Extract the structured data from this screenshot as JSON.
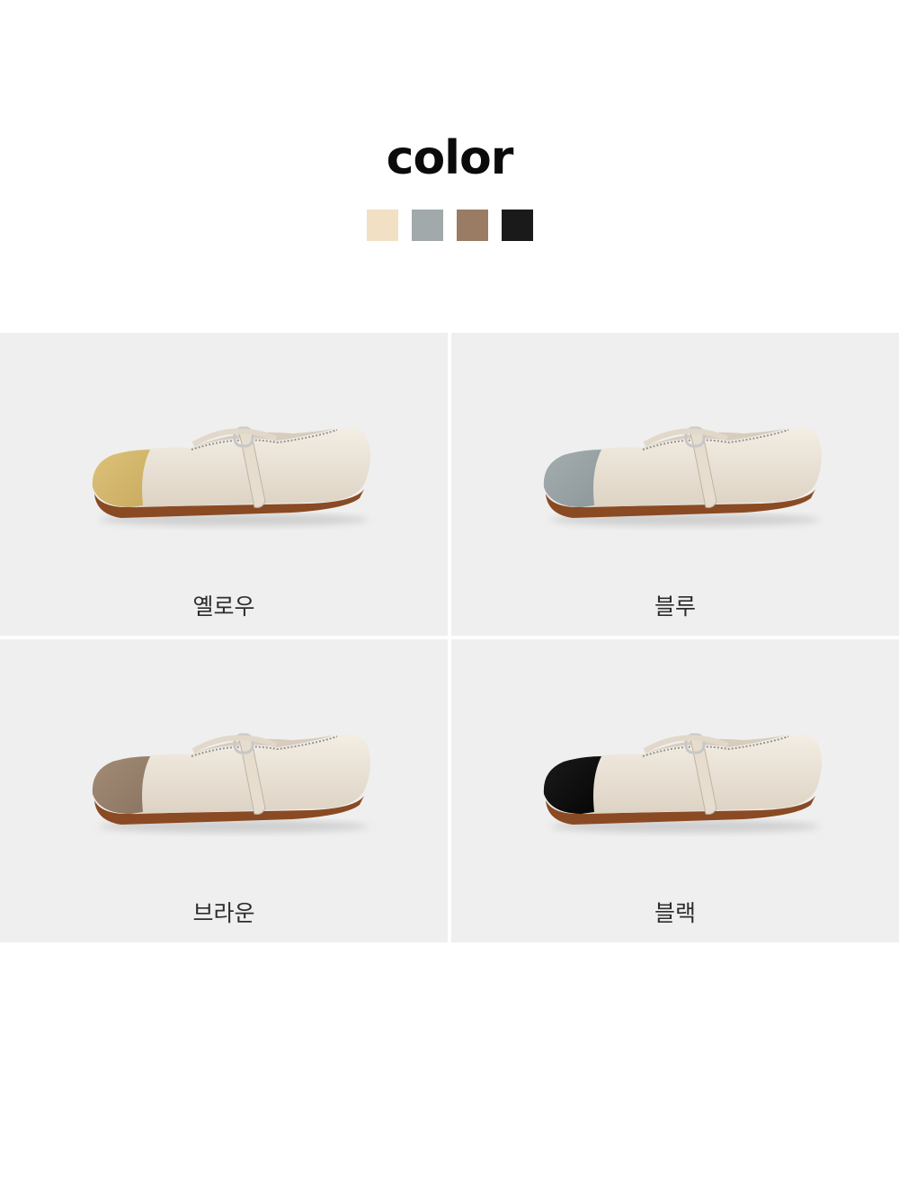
{
  "heading": "color",
  "swatches": [
    {
      "color": "#f1e0c4"
    },
    {
      "color": "#a1a9aa"
    },
    {
      "color": "#9a7b64"
    },
    {
      "color": "#1a1a1a"
    }
  ],
  "variants": [
    {
      "label": "옐로우",
      "toe_color": "#ddc27a",
      "toe_shade": "#c9ab5f"
    },
    {
      "label": "블루",
      "toe_color": "#a4adb0",
      "toe_shade": "#8e989b"
    },
    {
      "label": "브라운",
      "toe_color": "#a28c78",
      "toe_shade": "#8b7561"
    },
    {
      "label": "블랙",
      "toe_color": "#1b1b1b",
      "toe_shade": "#050505"
    }
  ],
  "colors": {
    "panel_bg": "#efefef",
    "upper": "#ebe3d6",
    "sole": "#8a4a23",
    "buckle": "#c7c7c7"
  }
}
